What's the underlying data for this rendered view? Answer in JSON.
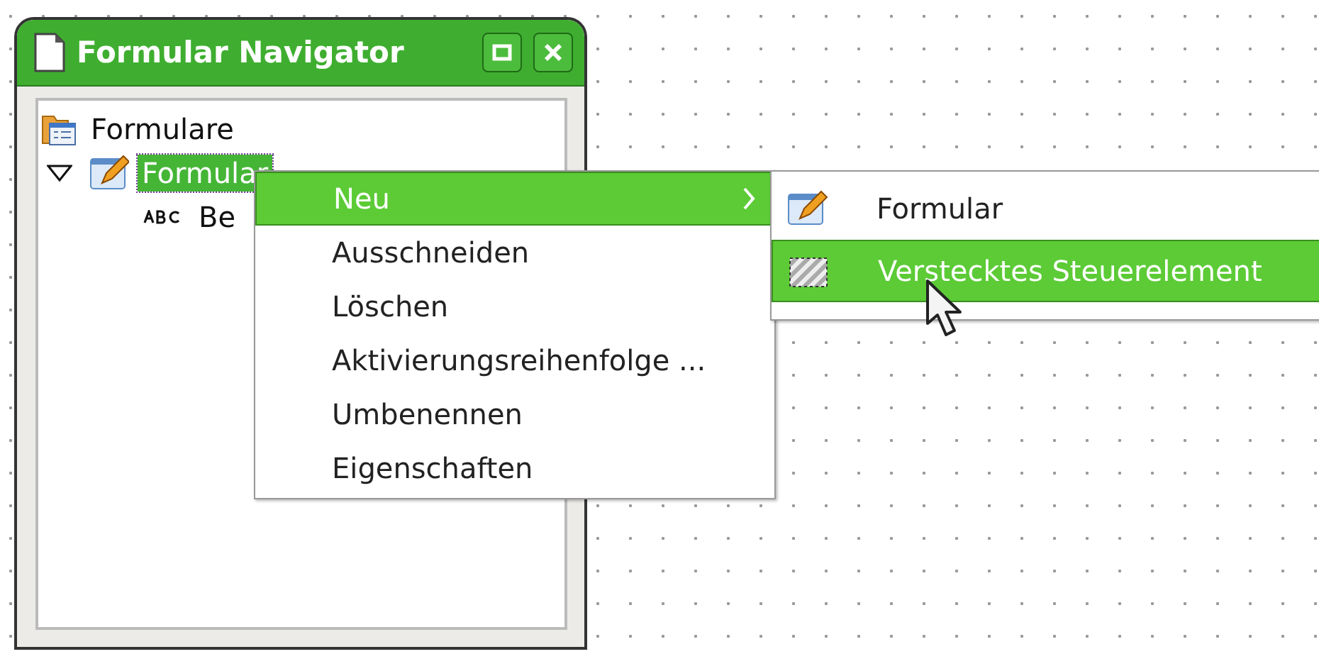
{
  "window": {
    "title": "Formular Navigator"
  },
  "tree": [
    {
      "label": "Formulare",
      "kind": "folder",
      "selected": false,
      "children": [
        {
          "label": "Formular",
          "kind": "form",
          "selected": true,
          "expanded": true,
          "children": [
            {
              "label": "Be",
              "kind": "text",
              "selected": false
            }
          ]
        }
      ]
    }
  ],
  "context_menu": {
    "items": [
      {
        "label": "Neu",
        "selected": true,
        "submenu": true
      },
      {
        "label": "Ausschneiden",
        "selected": false,
        "submenu": false
      },
      {
        "label": "Löschen",
        "selected": false,
        "submenu": false
      },
      {
        "label": "Aktivierungsreihenfolge ...",
        "selected": false,
        "submenu": false
      },
      {
        "label": "Umbenennen",
        "selected": false,
        "submenu": false
      },
      {
        "label": "Eigenschaften",
        "selected": false,
        "submenu": false
      }
    ]
  },
  "submenu": {
    "items": [
      {
        "label": "Formular",
        "kind": "form",
        "selected": false
      },
      {
        "label": "Verstecktes Steuerelement",
        "kind": "hidden",
        "selected": true
      }
    ]
  }
}
